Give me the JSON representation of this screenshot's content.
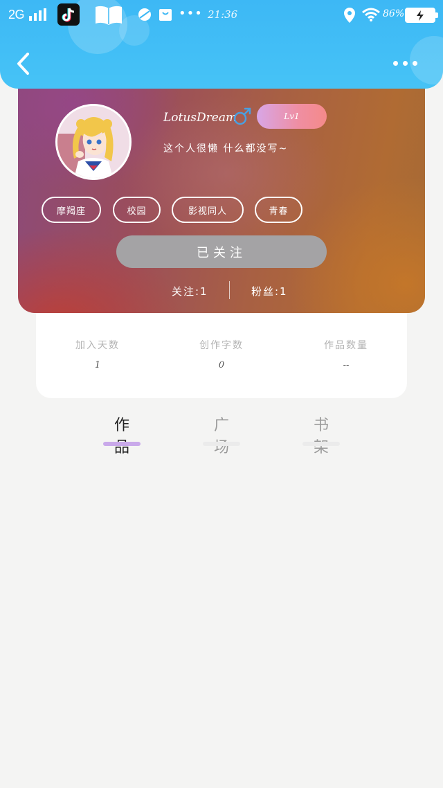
{
  "status_bar": {
    "network": "2G",
    "time": "21:36",
    "more": "•••",
    "battery_percent": "86%",
    "icons": [
      "signal-icon",
      "tiktok-icon",
      "book-icon",
      "pill-icon",
      "bag-icon",
      "location-icon",
      "wifi-icon",
      "battery-charging-icon"
    ]
  },
  "nav": {
    "back_icon": "chevron-left-icon",
    "more_icon": "more-dots-icon"
  },
  "profile": {
    "username": "LotusDream",
    "gender_symbol": "♂",
    "gender_color": "#4a9fe0",
    "level": "Lv1",
    "bio": "这个人很懒 什么都没写~",
    "tags": [
      "摩羯座",
      "校园",
      "影视同人",
      "青春"
    ],
    "follow_button": "已关注",
    "following": "关注:1",
    "fans": "粉丝:1"
  },
  "stats": [
    {
      "label": "加入天数",
      "value": "1"
    },
    {
      "label": "创作字数",
      "value": "0"
    },
    {
      "label": "作品数量",
      "value": "--"
    }
  ],
  "tabs": [
    {
      "label": "作品",
      "active": true
    },
    {
      "label": "广场",
      "active": false
    },
    {
      "label": "书架",
      "active": false
    }
  ],
  "colors": {
    "header_blue": "#3db8f5",
    "tab_active_underline": "#c9a9ea",
    "follow_button_bg": "#a4a3a5"
  }
}
